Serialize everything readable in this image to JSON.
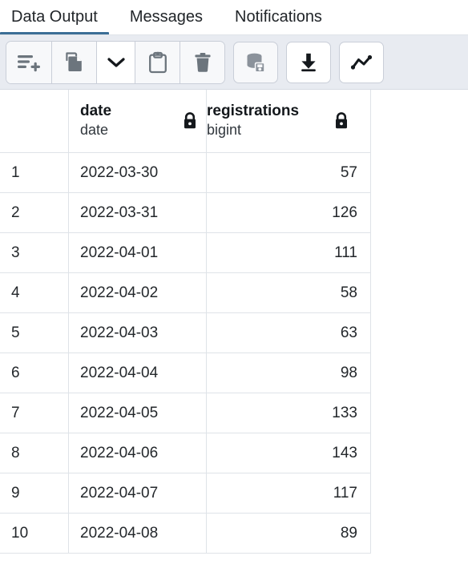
{
  "tabs": [
    {
      "label": "Data Output",
      "active": true
    },
    {
      "label": "Messages",
      "active": false
    },
    {
      "label": "Notifications",
      "active": false
    }
  ],
  "accent_color": "#3b6e96",
  "toolbar": {
    "groups": [
      {
        "buttons": [
          {
            "name": "add-rows-button",
            "icon": "lines-plus-icon",
            "state": "default"
          },
          {
            "name": "copy-button",
            "icon": "copy-icon",
            "state": "default"
          },
          {
            "name": "copy-options-button",
            "icon": "chevron-down-icon",
            "state": "highlighted"
          },
          {
            "name": "paste-button",
            "icon": "clipboard-icon",
            "state": "default"
          },
          {
            "name": "delete-button",
            "icon": "trash-icon",
            "state": "default"
          }
        ]
      }
    ],
    "solo_buttons": [
      {
        "name": "save-data-changes-button",
        "icon": "database-save-icon",
        "state": "disabled"
      },
      {
        "name": "download-results-button",
        "icon": "download-icon",
        "state": "active"
      },
      {
        "name": "graph-visualiser-button",
        "icon": "line-chart-icon",
        "state": "active"
      }
    ]
  },
  "grid": {
    "columns": [
      {
        "name": "",
        "type": ""
      },
      {
        "name": "date",
        "type": "date",
        "locked": true
      },
      {
        "name": "registrations",
        "type": "bigint",
        "locked": true
      }
    ],
    "rows": [
      {
        "num": "1",
        "date": "2022-03-30",
        "registrations": "57"
      },
      {
        "num": "2",
        "date": "2022-03-31",
        "registrations": "126"
      },
      {
        "num": "3",
        "date": "2022-04-01",
        "registrations": "111"
      },
      {
        "num": "4",
        "date": "2022-04-02",
        "registrations": "58"
      },
      {
        "num": "5",
        "date": "2022-04-03",
        "registrations": "63"
      },
      {
        "num": "6",
        "date": "2022-04-04",
        "registrations": "98"
      },
      {
        "num": "7",
        "date": "2022-04-05",
        "registrations": "133"
      },
      {
        "num": "8",
        "date": "2022-04-06",
        "registrations": "143"
      },
      {
        "num": "9",
        "date": "2022-04-07",
        "registrations": "117"
      },
      {
        "num": "10",
        "date": "2022-04-08",
        "registrations": "89"
      }
    ]
  }
}
